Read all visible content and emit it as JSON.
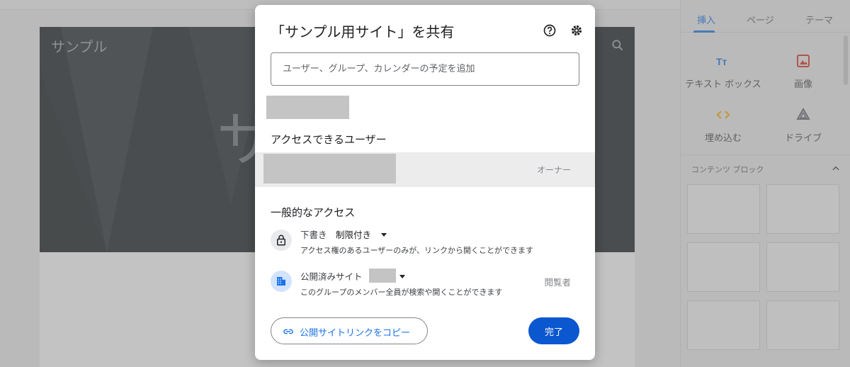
{
  "site": {
    "header_title": "サンプル",
    "hero_text": "サ"
  },
  "sidebar": {
    "tabs": [
      {
        "label": "挿入"
      },
      {
        "label": "ページ"
      },
      {
        "label": "テーマ"
      }
    ],
    "tools": [
      {
        "label": "テキスト ボックス",
        "icon": "text-box-icon"
      },
      {
        "label": "画像",
        "icon": "image-icon"
      },
      {
        "label": "埋め込む",
        "icon": "embed-icon"
      },
      {
        "label": "ドライブ",
        "icon": "drive-icon"
      }
    ],
    "content_blocks_title": "コンテンツ ブロック"
  },
  "dialog": {
    "title": "「サンプル用サイト」を共有",
    "add_placeholder": "ユーザー、グループ、カレンダーの予定を追加",
    "people_section_title": "アクセスできるユーザー",
    "owner_role": "オーナー",
    "general_access_title": "一般的なアクセス",
    "draft": {
      "name": "下書き",
      "value": "制限付き",
      "description": "アクセス権のあるユーザーのみが、リンクから開くことができます"
    },
    "published": {
      "name": "公開済みサイト",
      "description": "このグループのメンバー全員が検索や開くことができます",
      "role": "閲覧者"
    },
    "copy_link_label": "公開サイトリンクをコピー",
    "done_label": "完了"
  },
  "colors": {
    "accent": "#1a73e8",
    "primary_button": "#0b57d0",
    "hero_background": "#1e2427"
  }
}
